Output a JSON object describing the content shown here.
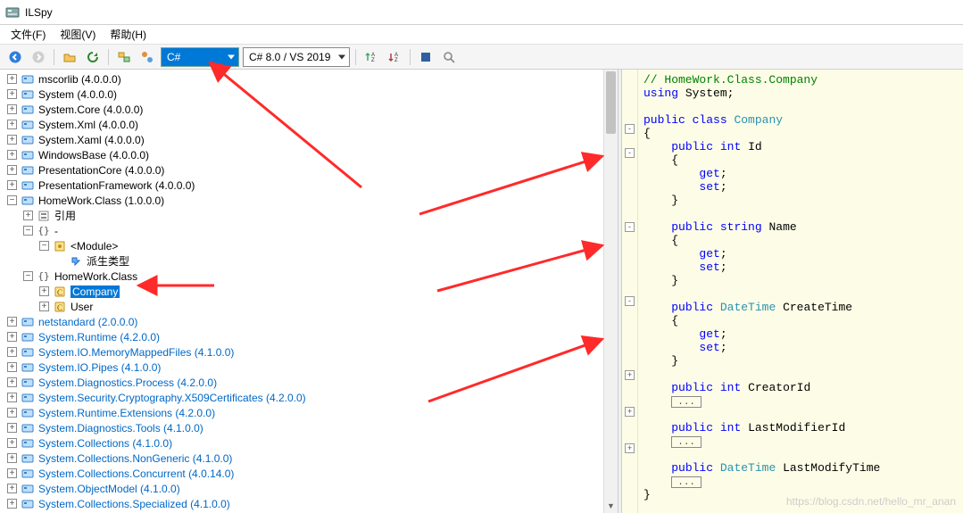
{
  "title": "ILSpy",
  "menu": {
    "file": "文件(F)",
    "view": "视图(V)",
    "help": "帮助(H)"
  },
  "toolbar": {
    "lang_selected": "C#",
    "framework_selected": "C# 8.0 / VS 2019"
  },
  "tree": {
    "items": [
      {
        "indent": 0,
        "toggle": "+",
        "icon": "assembly",
        "label": "mscorlib (4.0.0.0)",
        "link": false
      },
      {
        "indent": 0,
        "toggle": "+",
        "icon": "assembly",
        "label": "System (4.0.0.0)",
        "link": false
      },
      {
        "indent": 0,
        "toggle": "+",
        "icon": "assembly",
        "label": "System.Core (4.0.0.0)",
        "link": false
      },
      {
        "indent": 0,
        "toggle": "+",
        "icon": "assembly",
        "label": "System.Xml (4.0.0.0)",
        "link": false
      },
      {
        "indent": 0,
        "toggle": "+",
        "icon": "assembly",
        "label": "System.Xaml (4.0.0.0)",
        "link": false
      },
      {
        "indent": 0,
        "toggle": "+",
        "icon": "assembly",
        "label": "WindowsBase (4.0.0.0)",
        "link": false
      },
      {
        "indent": 0,
        "toggle": "+",
        "icon": "assembly",
        "label": "PresentationCore (4.0.0.0)",
        "link": false
      },
      {
        "indent": 0,
        "toggle": "+",
        "icon": "assembly",
        "label": "PresentationFramework (4.0.0.0)",
        "link": false
      },
      {
        "indent": 0,
        "toggle": "-",
        "icon": "assembly",
        "label": "HomeWork.Class (1.0.0.0)",
        "link": false
      },
      {
        "indent": 1,
        "toggle": "+",
        "icon": "references",
        "label": "引用",
        "link": false
      },
      {
        "indent": 1,
        "toggle": "-",
        "icon": "namespace",
        "label": "-",
        "link": false
      },
      {
        "indent": 2,
        "toggle": "-",
        "icon": "module",
        "label": "<Module>",
        "link": false
      },
      {
        "indent": 3,
        "toggle": "",
        "icon": "derived",
        "label": "派生类型",
        "link": false
      },
      {
        "indent": 1,
        "toggle": "-",
        "icon": "namespace",
        "label": "HomeWork.Class",
        "link": false
      },
      {
        "indent": 2,
        "toggle": "+",
        "icon": "class",
        "label": "Company",
        "link": false,
        "selected": true
      },
      {
        "indent": 2,
        "toggle": "+",
        "icon": "class",
        "label": "User",
        "link": false
      },
      {
        "indent": 0,
        "toggle": "+",
        "icon": "assembly",
        "label": "netstandard (2.0.0.0)",
        "link": true
      },
      {
        "indent": 0,
        "toggle": "+",
        "icon": "assembly",
        "label": "System.Runtime (4.2.0.0)",
        "link": true
      },
      {
        "indent": 0,
        "toggle": "+",
        "icon": "assembly",
        "label": "System.IO.MemoryMappedFiles (4.1.0.0)",
        "link": true
      },
      {
        "indent": 0,
        "toggle": "+",
        "icon": "assembly",
        "label": "System.IO.Pipes (4.1.0.0)",
        "link": true
      },
      {
        "indent": 0,
        "toggle": "+",
        "icon": "assembly",
        "label": "System.Diagnostics.Process (4.2.0.0)",
        "link": true
      },
      {
        "indent": 0,
        "toggle": "+",
        "icon": "assembly",
        "label": "System.Security.Cryptography.X509Certificates (4.2.0.0)",
        "link": true
      },
      {
        "indent": 0,
        "toggle": "+",
        "icon": "assembly",
        "label": "System.Runtime.Extensions (4.2.0.0)",
        "link": true
      },
      {
        "indent": 0,
        "toggle": "+",
        "icon": "assembly",
        "label": "System.Diagnostics.Tools (4.1.0.0)",
        "link": true
      },
      {
        "indent": 0,
        "toggle": "+",
        "icon": "assembly",
        "label": "System.Collections (4.1.0.0)",
        "link": true
      },
      {
        "indent": 0,
        "toggle": "+",
        "icon": "assembly",
        "label": "System.Collections.NonGeneric (4.1.0.0)",
        "link": true
      },
      {
        "indent": 0,
        "toggle": "+",
        "icon": "assembly",
        "label": "System.Collections.Concurrent (4.0.14.0)",
        "link": true
      },
      {
        "indent": 0,
        "toggle": "+",
        "icon": "assembly",
        "label": "System.ObjectModel (4.1.0.0)",
        "link": true
      },
      {
        "indent": 0,
        "toggle": "+",
        "icon": "assembly",
        "label": "System.Collections.Specialized (4.1.0.0)",
        "link": true
      }
    ]
  },
  "code": {
    "header_comment": "// HomeWork.Class.Company",
    "using_kw": "using",
    "using_ns": "System",
    "public_kw": "public",
    "class_kw": "class",
    "class_name": "Company",
    "int_kw": "int",
    "string_kw": "string",
    "datetime_type": "DateTime",
    "get_kw": "get",
    "set_kw": "set",
    "prop_id": "Id",
    "prop_name": "Name",
    "prop_createtime": "CreateTime",
    "prop_creatorid": "CreatorId",
    "prop_lastmodifierid": "LastModifierId",
    "prop_lastmodifytime": "LastModifyTime",
    "collapsed": "..."
  },
  "watermark": "https://blog.csdn.net/hello_mr_anan"
}
